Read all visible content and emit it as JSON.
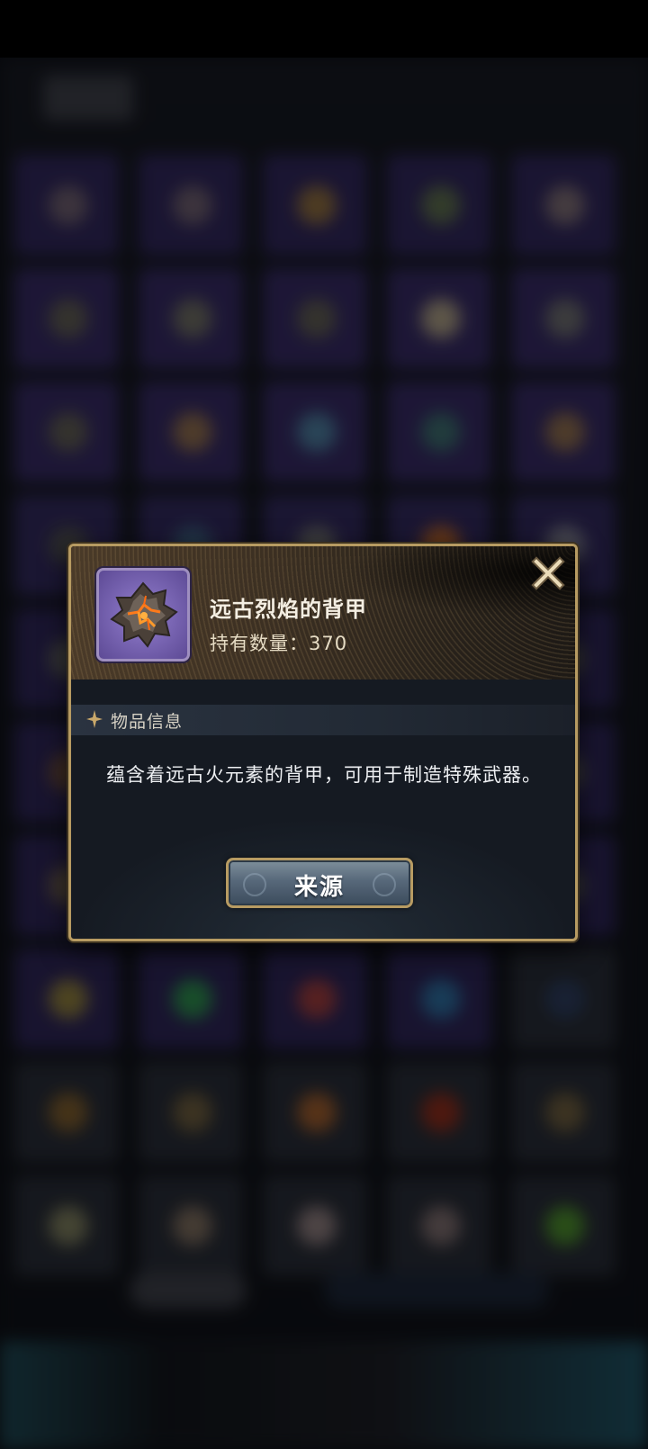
{
  "dialog": {
    "item_name": "远古烈焰的背甲",
    "count_label": "持有数量：",
    "count_value": "370",
    "section_title": "物品信息",
    "description": "蕴含着远古火元素的背甲，可用于制造特殊武器。",
    "source_button_label": "来源"
  },
  "icons": {
    "item": "flame-rock-shell-icon",
    "close": "close-icon",
    "section": "sparkle-star-icon"
  },
  "colors": {
    "item_rarity": "#7b67b5",
    "dialog_border": "#b79b62",
    "accent_gold": "#c9a86a",
    "description_text": "#eef0f3"
  },
  "background_inventory": {
    "cells": [
      "#2e2558",
      "#2e2558",
      "#2e2558",
      "#2e2558",
      "#2e2558",
      "#33285f",
      "#33285f",
      "#33285f",
      "#33285f",
      "#33285f",
      "#33285f",
      "#33285f",
      "#33285f",
      "#33285f",
      "#33285f",
      "#2f2759",
      "#2f2759",
      "#2f2759",
      "#2f2759",
      "#2f2759",
      "#2b2353",
      "#2b2353",
      "#2b2353",
      "#2b2353",
      "#2b2353",
      "#2b2353",
      "#2b2353",
      "#2b2353",
      "#2b2353",
      "#2b2353",
      "#2b2353",
      "#2b2353",
      "#2b2353",
      "#2b2353",
      "#2b2353",
      "#2b2353",
      "#2b2353",
      "#2b2353",
      "#2b2353",
      "#262a33",
      "#262a33",
      "#262a33",
      "#262a33",
      "#262a33",
      "#262a33",
      "#262a33",
      "#262a33",
      "#262a33",
      "#262a33",
      "#262a33"
    ],
    "blobs": [
      "#6b5c6a",
      "#6b5c6a",
      "#8a6a3c",
      "#5a6a4a",
      "#7a6a70",
      "#5d5a50",
      "#6b6a60",
      "#5d5a50",
      "#a79a80",
      "#6a6a6a",
      "#5d5a50",
      "#8b6a4a",
      "#4a7a9a",
      "#3a6a6a",
      "#8a6a4a",
      "#4a4a4a",
      "#3a5a7a",
      "#6a6a6a",
      "#b0602a",
      "#7a7a8a",
      "#5a5a5a",
      "#5a5a5a",
      "#5a5a5a",
      "#5a5a5a",
      "#5a5a5a",
      "#6a4a3a",
      "#5a5a5a",
      "#5a5a5a",
      "#5a5a5a",
      "#5a5a5a",
      "#6a5a4a",
      "#5a5a5a",
      "#5a5a5a",
      "#5a5a5a",
      "#5a5a5a",
      "#8a7a3a",
      "#2a8a4a",
      "#9a3a3a",
      "#2a6a9a",
      "#2a3a5a",
      "#7a5a2a",
      "#6a5a3a",
      "#9a5a2a",
      "#8a2a1a",
      "#6a5a3a",
      "#7a7a5a",
      "#7a6a5a",
      "#8a7a7a",
      "#7a6a6a",
      "#4a8a2a"
    ]
  }
}
